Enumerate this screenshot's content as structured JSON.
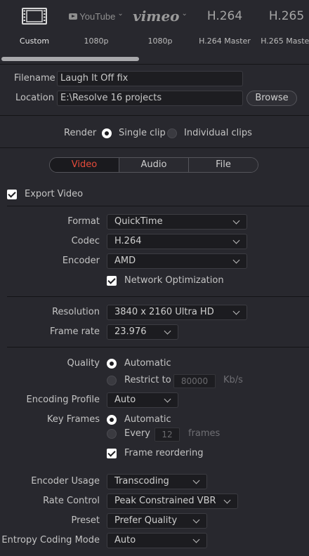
{
  "presets": [
    {
      "label": "Custom",
      "icon": "film-icon"
    },
    {
      "label": "1080p",
      "logo": "YouTube",
      "icon": "youtube-icon"
    },
    {
      "label": "1080p",
      "logo": "vimeo",
      "icon": "vimeo-icon"
    },
    {
      "label": "H.264 Master",
      "logo": "H.264"
    },
    {
      "label": "H.265 Master",
      "logo": "H.265"
    }
  ],
  "file": {
    "filename_label": "Filename",
    "filename_value": "Laugh It Off fix",
    "location_label": "Location",
    "location_value": "E:\\Resolve 16 projects",
    "browse_label": "Browse"
  },
  "render": {
    "label": "Render",
    "single_clip": "Single clip",
    "individual_clips": "Individual clips",
    "selected": "single_clip"
  },
  "tabs": [
    "Video",
    "Audio",
    "File"
  ],
  "active_tab": "Video",
  "video": {
    "export_video_label": "Export Video",
    "format_label": "Format",
    "format_value": "QuickTime",
    "codec_label": "Codec",
    "codec_value": "H.264",
    "encoder_label": "Encoder",
    "encoder_value": "AMD",
    "network_optimization_label": "Network Optimization",
    "resolution_label": "Resolution",
    "resolution_value": "3840 x 2160 Ultra HD",
    "frame_rate_label": "Frame rate",
    "frame_rate_value": "23.976",
    "quality_label": "Quality",
    "quality_automatic": "Automatic",
    "quality_restrict": "Restrict to",
    "quality_restrict_value": "80000",
    "quality_unit": "Kb/s",
    "encoding_profile_label": "Encoding Profile",
    "encoding_profile_value": "Auto",
    "key_frames_label": "Key Frames",
    "key_frames_automatic": "Automatic",
    "key_frames_every": "Every",
    "key_frames_every_value": "12",
    "key_frames_unit": "frames",
    "frame_reordering_label": "Frame reordering",
    "encoder_usage_label": "Encoder Usage",
    "encoder_usage_value": "Transcoding",
    "rate_control_label": "Rate Control",
    "rate_control_value": "Peak Constrained VBR",
    "preset_label": "Preset",
    "preset_value": "Prefer Quality",
    "entropy_label": "Entropy Coding Mode",
    "entropy_value": "Auto"
  },
  "colors": {
    "background": "#28282e",
    "active_tab_text": "#e64b3b",
    "field_background": "#1c1c20"
  }
}
